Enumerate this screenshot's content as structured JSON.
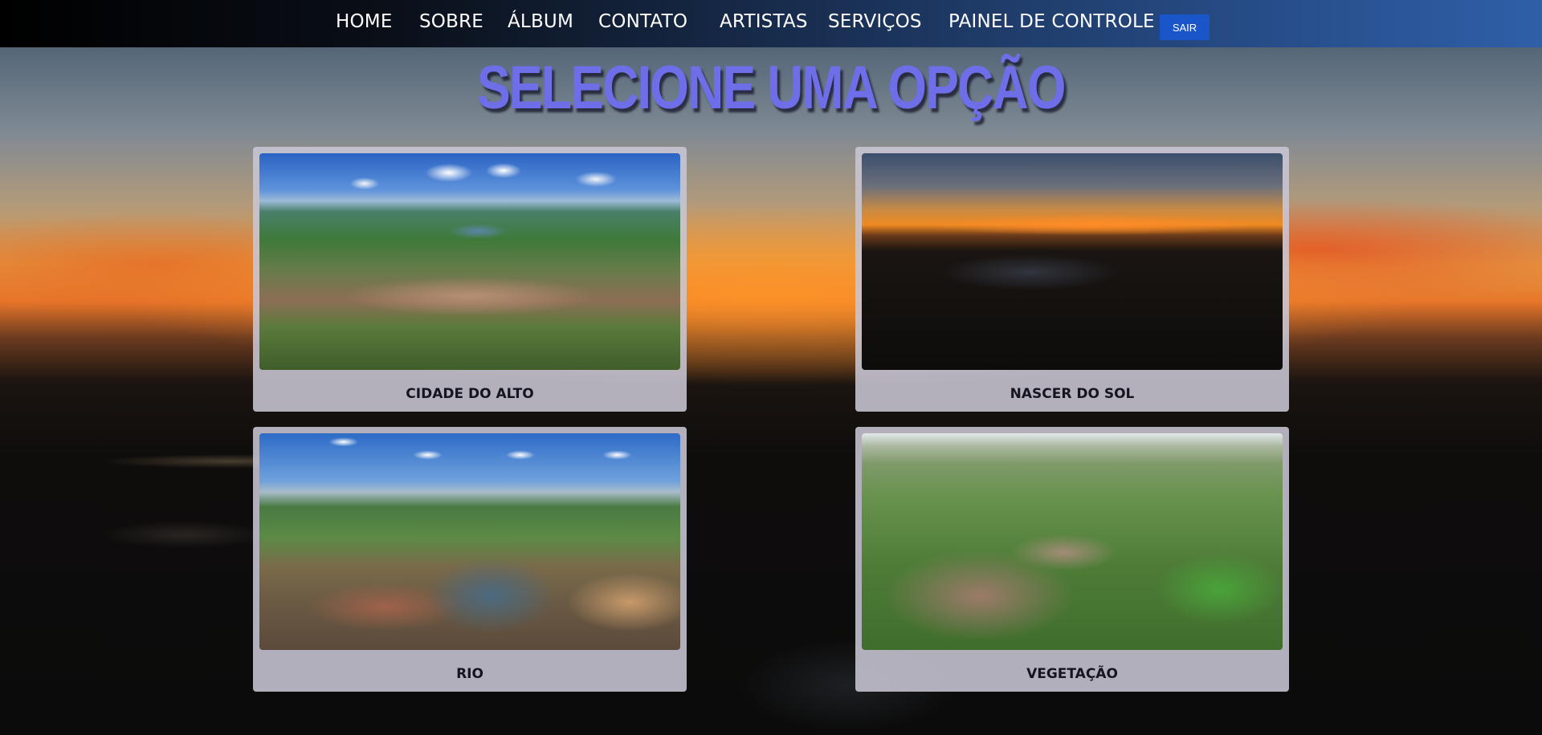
{
  "nav": {
    "items": [
      {
        "label": "HOME",
        "name": "nav-home"
      },
      {
        "label": "SOBRE",
        "name": "nav-sobre"
      },
      {
        "label": "ÁLBUM",
        "name": "nav-album"
      },
      {
        "label": "CONTATO",
        "name": "nav-contato"
      },
      {
        "label": "ARTISTAS",
        "name": "nav-artistas"
      },
      {
        "label": "SERVIÇOS",
        "name": "nav-servicos"
      },
      {
        "label": "PAINEL DE CONTROLE",
        "name": "nav-painel-de-controle"
      }
    ],
    "logout_label": "SAIR"
  },
  "page": {
    "title": "SELECIONE UMA OPÇÃO"
  },
  "cards": [
    {
      "label": "CIDADE DO ALTO",
      "image": "aerial-city-photo"
    },
    {
      "label": "NASCER DO SOL",
      "image": "sunrise-river-photo"
    },
    {
      "label": "RIO",
      "image": "aerial-river-photo"
    },
    {
      "label": "VEGETAÇÃO",
      "image": "aerial-vegetation-photo"
    }
  ],
  "colors": {
    "title": "#6e6ee8",
    "logout_button": "#1a56c9",
    "card_background": "#c8c6d4"
  }
}
